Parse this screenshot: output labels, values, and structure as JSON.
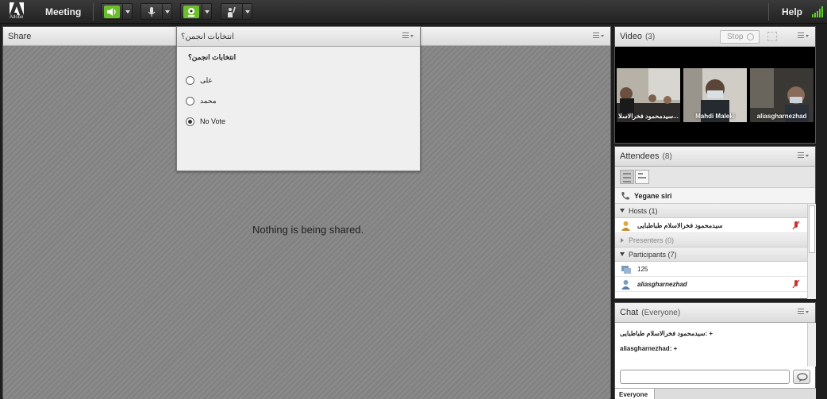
{
  "topbar": {
    "logo_label": "Adobe",
    "meeting_menu": "Meeting",
    "help_menu": "Help",
    "accent_color": "#6bbf2a"
  },
  "share_pod": {
    "title": "Share",
    "empty_message": "Nothing is being shared."
  },
  "poll": {
    "title": "انتخابات انجمن؟",
    "question": "انتخابات انجمن؟",
    "options": [
      {
        "label": "علی",
        "selected": false
      },
      {
        "label": "محمد",
        "selected": false
      },
      {
        "label": "No Vote",
        "selected": true
      }
    ]
  },
  "video_pod": {
    "title": "Video",
    "count": "(3)",
    "stop_label": "Stop",
    "tiles": [
      {
        "name": "سیدمحمود فخرالاسلا..."
      },
      {
        "name": "Mahdi Maleki"
      },
      {
        "name": "aliasgharnezhad"
      }
    ]
  },
  "attendees_pod": {
    "title": "Attendees",
    "count": "(8)",
    "me": "Yegane siri",
    "groups": {
      "hosts": "Hosts (1)",
      "presenters": "Presenters (0)",
      "participants": "Participants (7)"
    },
    "hosts": [
      "سیدمحمود فخرالاسلام طباطبایی"
    ],
    "participants": [
      "125",
      "aliasgharnezhad"
    ]
  },
  "chat_pod": {
    "title": "Chat",
    "scope": "(Everyone)",
    "messages": [
      "سیدمحمود فخرالاسلام طباطبایی: +",
      "aliasgharnezhad: +"
    ],
    "input_placeholder": "",
    "tab_label": "Everyone"
  }
}
